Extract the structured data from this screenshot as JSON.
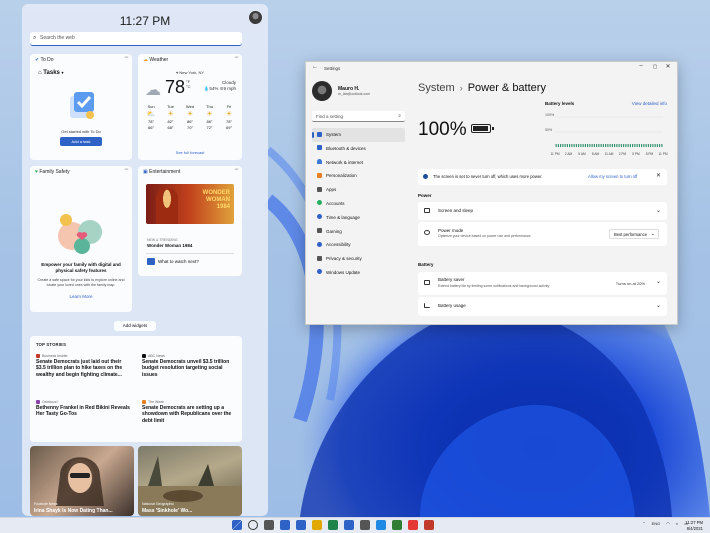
{
  "widgets": {
    "time": "11:27 PM",
    "search_placeholder": "Search the web",
    "add_widgets_label": "Add widgets",
    "todo": {
      "title": "To Do",
      "list": "Tasks",
      "prompt": "Get started with To Do",
      "button": "Add a task"
    },
    "weather": {
      "title": "Weather",
      "location": "New York, NY",
      "temp": "78",
      "units": "°F\n°C",
      "cond_lines": [
        "Cloudy",
        "54%",
        "9 mph"
      ],
      "days": [
        {
          "d": "Sun",
          "hi": "78°",
          "lo": "66°"
        },
        {
          "d": "Tue",
          "hi": "82°",
          "lo": "68°"
        },
        {
          "d": "Wed",
          "hi": "86°",
          "lo": "70°"
        },
        {
          "d": "Thu",
          "hi": "86°",
          "lo": "72°"
        },
        {
          "d": "Fri",
          "hi": "78°",
          "lo": "69°"
        }
      ],
      "link": "See full forecast"
    },
    "family": {
      "title": "Family Safety",
      "headline": "Empower your family with digital and physical safety features",
      "body": "Create a safe space for your kids to explore online and locate your loved ones with the family map.",
      "link": "Learn More"
    },
    "entertainment": {
      "title": "Entertainment",
      "poster_text": "WONDER\nWOMAN\n1984",
      "tag": "NEW & TRENDING",
      "movie": "Wonder Woman 1984",
      "question": "What to watch next?"
    },
    "top_stories": {
      "title": "TOP STORIES",
      "items": [
        {
          "source": "Business Insider",
          "headline": "Senate Democrats just laid out their $3.5 trillion plan to hike taxes on the wealthy and begin fighting climate...",
          "color": "#c0392b"
        },
        {
          "source": "ABC News",
          "headline": "Senate Democrats unveil $3.5 trillion budget resolution targeting social issues",
          "color": "#111111"
        },
        {
          "source": "Celebuzz!",
          "headline": "Bethenny Frankel in Red Bikini Reveals Her Tasty Go-Tos",
          "color": "#8e44ad"
        },
        {
          "source": "The Week",
          "headline": "Senate Democrats are setting up a showdown with Republicans over the debt limit",
          "color": "#e67e22"
        }
      ]
    },
    "photos": [
      {
        "source": "Footnote News",
        "headline": "Irina Shayk Is Now Dating Than..."
      },
      {
        "source": "National Geographic",
        "headline": "Mass 'Sinkhole' Wo..."
      }
    ]
  },
  "settings": {
    "window_title": "Settings",
    "user_name": "Mauro H.",
    "user_email": "m_lab@outlook.com",
    "find_placeholder": "Find a setting",
    "nav": [
      {
        "label": "System",
        "color": "#2f62c7",
        "active": true
      },
      {
        "label": "Bluetooth & devices",
        "color": "#2f62c7"
      },
      {
        "label": "Network & internet",
        "color": "#3c78d8"
      },
      {
        "label": "Personalization",
        "color": "#e67e22"
      },
      {
        "label": "Apps",
        "color": "#555555"
      },
      {
        "label": "Accounts",
        "color": "#27ae60"
      },
      {
        "label": "Time & language",
        "color": "#2f62c7"
      },
      {
        "label": "Gaming",
        "color": "#555555"
      },
      {
        "label": "Accessibility",
        "color": "#2f62c7"
      },
      {
        "label": "Privacy & security",
        "color": "#555555"
      },
      {
        "label": "Windows Update",
        "color": "#2f62c7"
      }
    ],
    "breadcrumb_parent": "System",
    "breadcrumb_sep": "›",
    "page_title": "Power & battery",
    "battery_percent": "100%",
    "battery_fill_fraction": 1.0,
    "battery_levels_title": "Battery levels",
    "view_details": "View detailed info",
    "info_text": "The screen is set to never turn off, which uses more power.",
    "info_link": "Allow my screen to turn off",
    "power_section": "Power",
    "screen_sleep": "Screen and sleep",
    "power_mode": "Power mode",
    "power_mode_desc": "Optimize your device based on power use and performance",
    "power_mode_value": "Best performance",
    "battery_section": "Battery",
    "battery_saver": "Battery saver",
    "battery_saver_desc": "Extend battery life by limiting some notifications and background activity",
    "battery_saver_value": "Turns on at 20%",
    "battery_usage": "Battery usage"
  },
  "chart_data": {
    "type": "bar",
    "title": "Battery levels",
    "categories": [
      "11 PM",
      "",
      "",
      "",
      "",
      "",
      "",
      "",
      "",
      "",
      "",
      "",
      "",
      "",
      "",
      "",
      "",
      "",
      "",
      "",
      "",
      "",
      "",
      "",
      "",
      "",
      "",
      "",
      "",
      "",
      "",
      "",
      "",
      "",
      "",
      "",
      "",
      "",
      "",
      "",
      "",
      "",
      "",
      "",
      "",
      "",
      "",
      ""
    ],
    "tick_labels": [
      "11 PM",
      "2 AM",
      "5 AM",
      "8 AM",
      "11 AM",
      "2 PM",
      "5 PM",
      "8 PM",
      "11 PM"
    ],
    "values": [
      100,
      100,
      100,
      100,
      100,
      100,
      100,
      100,
      100,
      100,
      100,
      100,
      100,
      100,
      100,
      100,
      100,
      100,
      100,
      100,
      100,
      100,
      100,
      100,
      100,
      100,
      100,
      100,
      100,
      100,
      100,
      100,
      100,
      100,
      100,
      100,
      100,
      100,
      100,
      100,
      100,
      100,
      100,
      100,
      100,
      100,
      100,
      100
    ],
    "ylim": [
      0,
      100
    ],
    "ytick_labels": [
      "100%",
      "50%"
    ],
    "grid": true
  },
  "taskbar": {
    "icon_colors": [
      "#2f62c7",
      "#333333",
      "#555555",
      "#2f62c7",
      "#2f62c7",
      "#e0a800",
      "#1e8449",
      "#2f62c7",
      "#555555",
      "#1e88e5",
      "#2e7d32",
      "#e53935",
      "#c0392b"
    ],
    "lang": "ENG",
    "time": "11:27 PM",
    "date": "6/4/2021"
  }
}
